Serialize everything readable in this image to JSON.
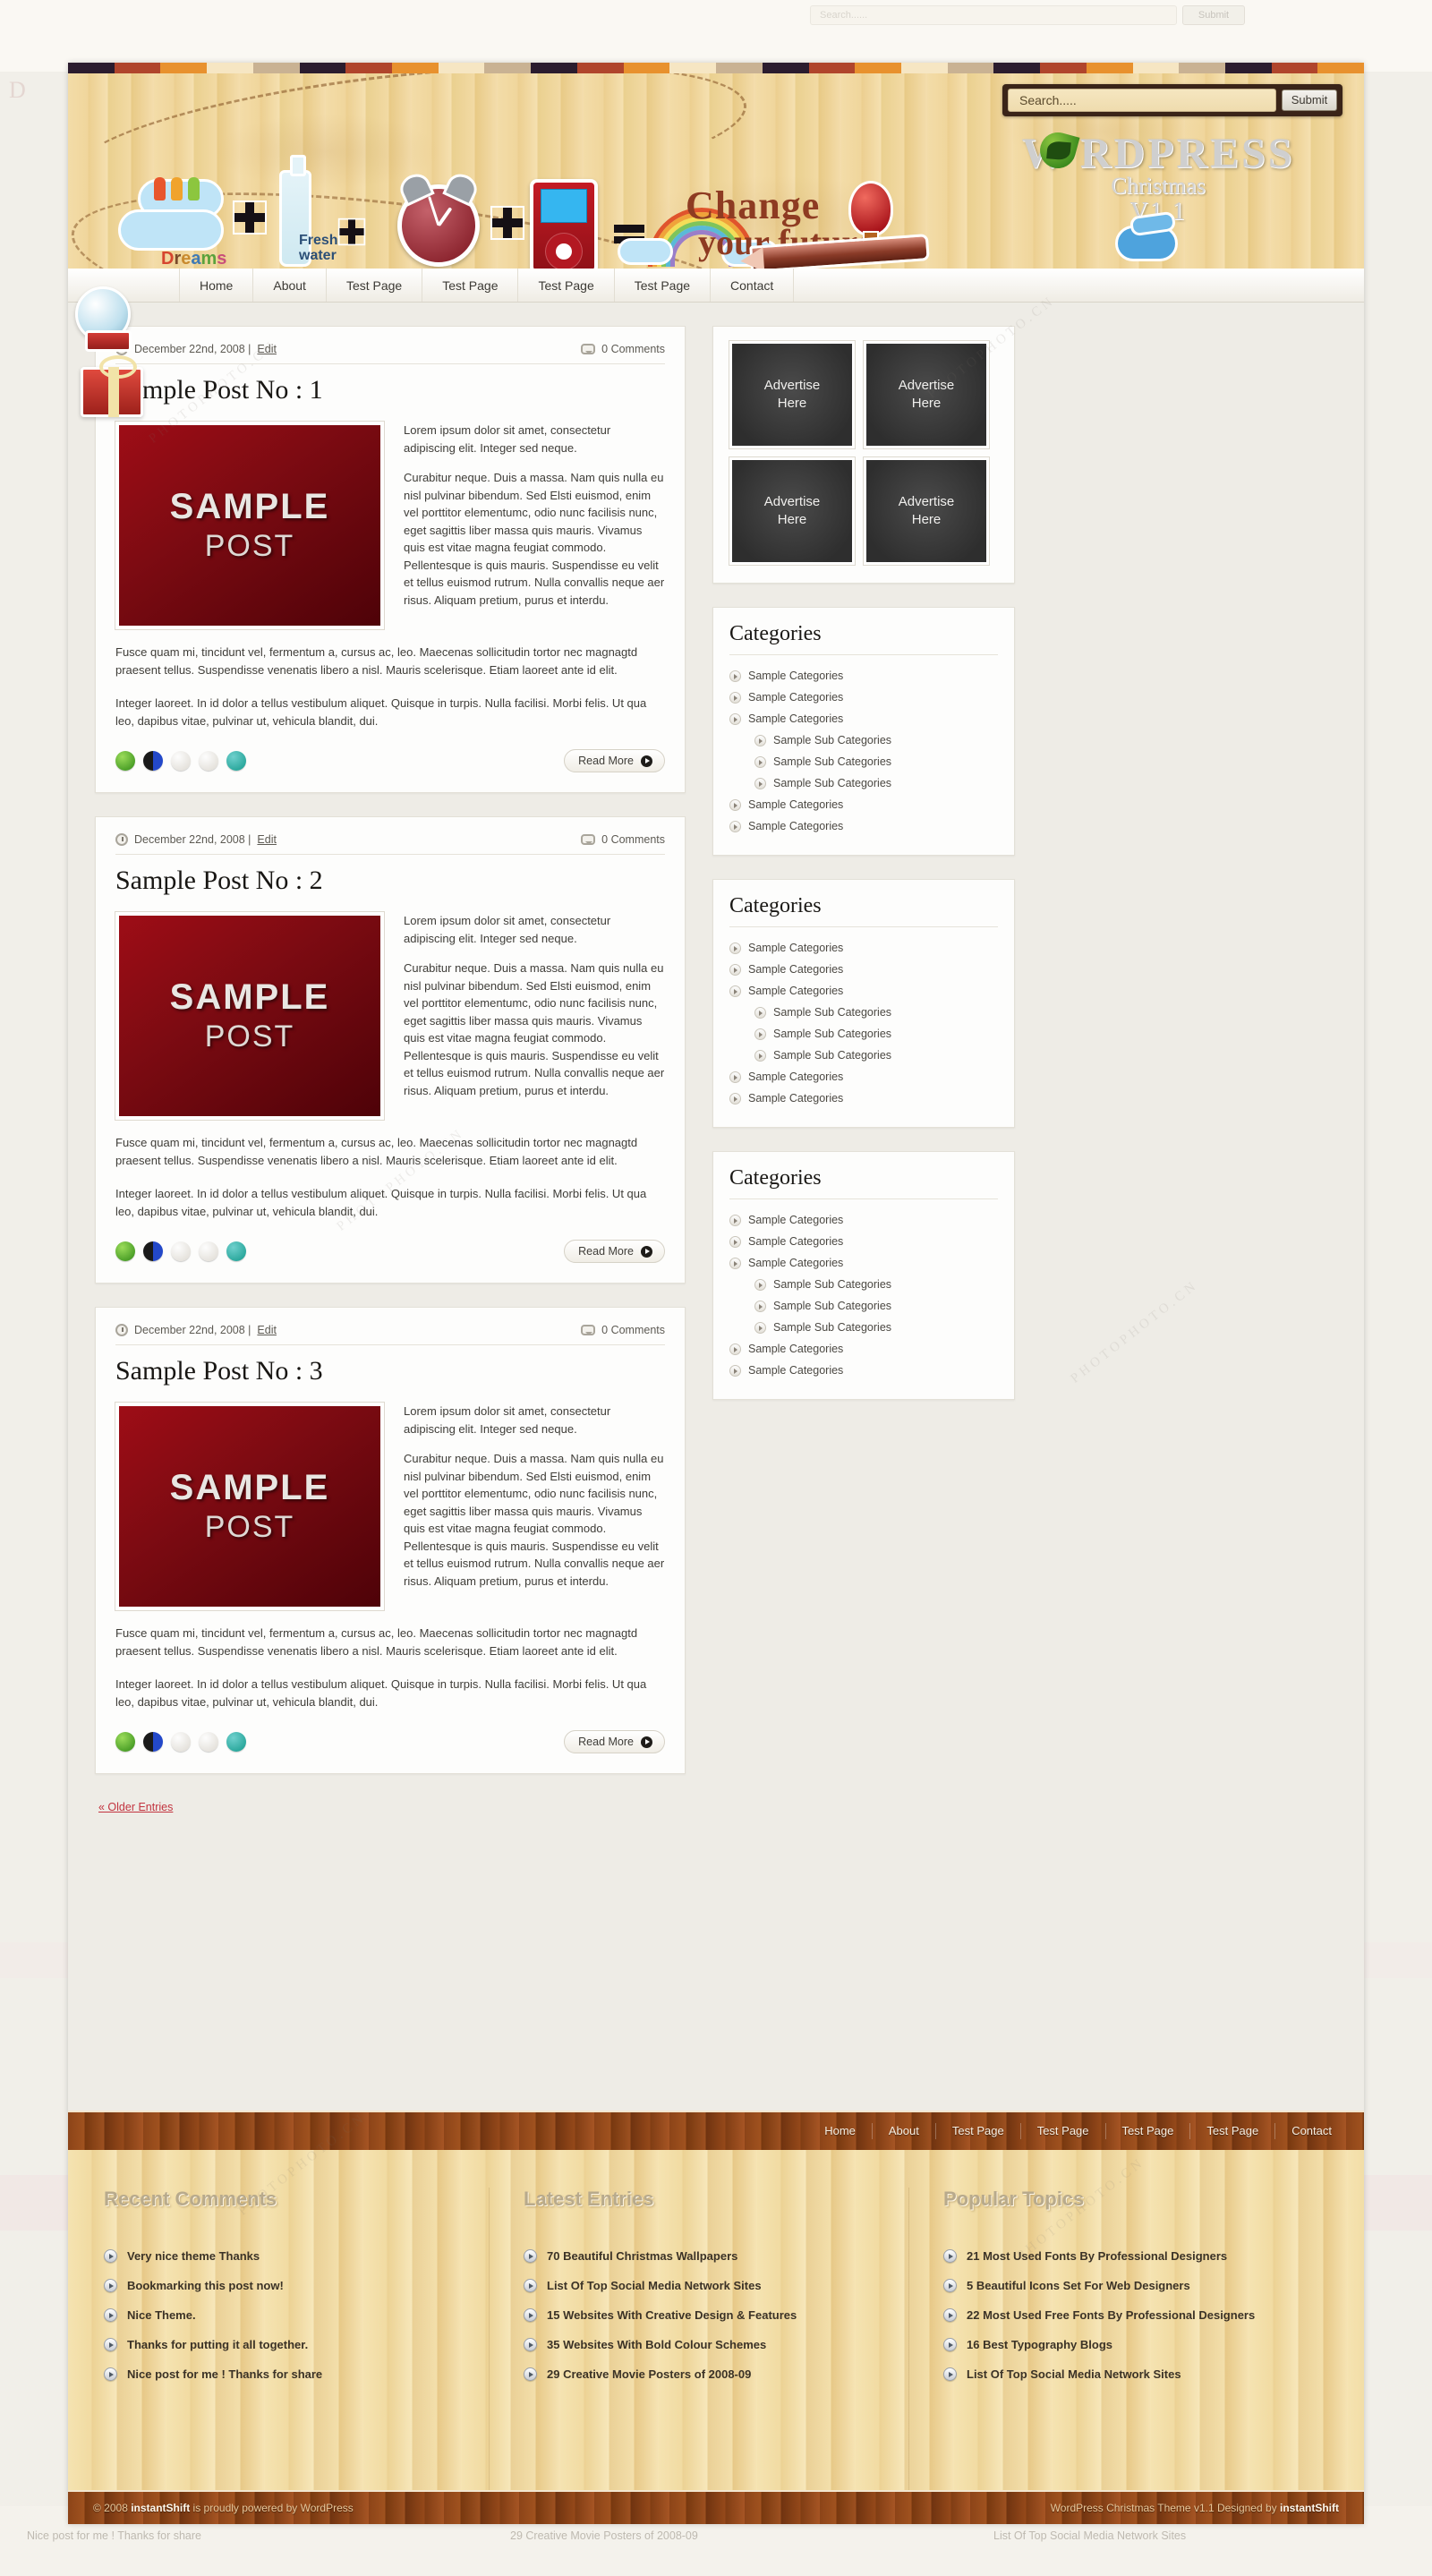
{
  "bleed": {
    "search_placeholder": "Search......",
    "submit_label": "Submit",
    "bottom_items": [
      "Nice post for me ! Thanks for share",
      "29 Creative Movie Posters of 2008-09",
      "List Of Top Social Media Network Sites"
    ]
  },
  "header": {
    "search_placeholder": "Search.....",
    "submit_label": "Submit",
    "logo": {
      "main": "W  RDPRESS",
      "sub": "Christmas",
      "version": "V1.1"
    },
    "illustration": {
      "dreams_label": "Dreams",
      "fresh_label_1": "Fresh",
      "fresh_label_2": "water",
      "tagline_1": "Change",
      "tagline_2": "your future"
    }
  },
  "nav": {
    "items": [
      {
        "label": "Home"
      },
      {
        "label": "About"
      },
      {
        "label": "Test Page"
      },
      {
        "label": "Test Page"
      },
      {
        "label": "Test Page"
      },
      {
        "label": "Test Page"
      },
      {
        "label": "Contact"
      }
    ]
  },
  "posts": [
    {
      "date": "December 22nd, 2008 |",
      "edit": "Edit",
      "comments": "0 Comments",
      "title": "Sample Post No : 1",
      "image_line1": "SAMPLE",
      "image_line2": "POST",
      "intro_1": "Lorem ipsum dolor sit amet, consectetur adipiscing elit. Integer sed neque.",
      "intro_2": "Curabitur neque. Duis a massa. Nam quis nulla eu nisl pulvinar bibendum. Sed Elsti euismod, enim vel porttitor elementumc, odio nunc facilisis nunc, eget sagittis liber massa quis mauris. Vivamus quis est vitae magna feugiat commodo. Pellentesque is quis mauris. Suspendisse eu velit et tellus euismod rutrum. Nulla convallis neque aer risus. Aliquam pretium, purus et interdu.",
      "body_1": "Fusce quam mi, tincidunt vel, fermentum a, cursus ac, leo. Maecenas sollicitudin tortor nec magnagtd praesent tellus. Suspendisse venenatis libero a nisl. Mauris scelerisque. Etiam laoreet ante id elit.",
      "body_2": "Integer laoreet. In id dolor a tellus vestibulum aliquet. Quisque in turpis. Nulla facilisi. Morbi felis. Ut qua leo, dapibus vitae, pulvinar ut, vehicula blandit, dui.",
      "read_more": "Read More"
    },
    {
      "date": "December 22nd, 2008 |",
      "edit": "Edit",
      "comments": "0 Comments",
      "title": "Sample Post No : 2",
      "image_line1": "SAMPLE",
      "image_line2": "POST",
      "intro_1": "Lorem ipsum dolor sit amet, consectetur adipiscing elit. Integer sed neque.",
      "intro_2": "Curabitur neque. Duis a massa. Nam quis nulla eu nisl pulvinar bibendum. Sed Elsti euismod, enim vel porttitor elementumc, odio nunc facilisis nunc, eget sagittis liber massa quis mauris. Vivamus quis est vitae magna feugiat commodo. Pellentesque is quis mauris. Suspendisse eu velit et tellus euismod rutrum. Nulla convallis neque aer risus. Aliquam pretium, purus et interdu.",
      "body_1": "Fusce quam mi, tincidunt vel, fermentum a, cursus ac, leo. Maecenas sollicitudin tortor nec magnagtd praesent tellus. Suspendisse venenatis libero a nisl. Mauris scelerisque. Etiam laoreet ante id elit.",
      "body_2": "Integer laoreet. In id dolor a tellus vestibulum aliquet. Quisque in turpis. Nulla facilisi. Morbi felis. Ut qua leo, dapibus vitae, pulvinar ut, vehicula blandit, dui.",
      "read_more": "Read More"
    },
    {
      "date": "December 22nd, 2008 |",
      "edit": "Edit",
      "comments": "0 Comments",
      "title": "Sample Post No : 3",
      "image_line1": "SAMPLE",
      "image_line2": "POST",
      "intro_1": "Lorem ipsum dolor sit amet, consectetur adipiscing elit. Integer sed neque.",
      "intro_2": "Curabitur neque. Duis a massa. Nam quis nulla eu nisl pulvinar bibendum. Sed Elsti euismod, enim vel porttitor elementumc, odio nunc facilisis nunc, eget sagittis liber massa quis mauris. Vivamus quis est vitae magna feugiat commodo. Pellentesque is quis mauris. Suspendisse eu velit et tellus euismod rutrum. Nulla convallis neque aer risus. Aliquam pretium, purus et interdu.",
      "body_1": "Fusce quam mi, tincidunt vel, fermentum a, cursus ac, leo. Maecenas sollicitudin tortor nec magnagtd praesent tellus. Suspendisse venenatis libero a nisl. Mauris scelerisque. Etiam laoreet ante id elit.",
      "body_2": "Integer laoreet. In id dolor a tellus vestibulum aliquet. Quisque in turpis. Nulla facilisi. Morbi felis. Ut qua leo, dapibus vitae, pulvinar ut, vehicula blandit, dui.",
      "read_more": "Read More"
    }
  ],
  "pagination": {
    "older_label": "« Older Entries"
  },
  "social_icons": [
    {
      "name": "technorati-icon",
      "glyph": ""
    },
    {
      "name": "mixx-icon",
      "glyph": ""
    },
    {
      "name": "yahoo-buzz-icon",
      "glyph": ""
    },
    {
      "name": "reddit-icon",
      "glyph": ""
    },
    {
      "name": "stumbleupon-icon",
      "glyph": "su"
    }
  ],
  "sidebar": {
    "ads": [
      {
        "line1": "Advertise",
        "line2": "Here"
      },
      {
        "line1": "Advertise",
        "line2": "Here"
      },
      {
        "line1": "Advertise",
        "line2": "Here"
      },
      {
        "line1": "Advertise",
        "line2": "Here"
      }
    ],
    "category_widgets": [
      {
        "title": "Categories",
        "items": [
          {
            "label": "Sample Categories",
            "sub": false
          },
          {
            "label": "Sample Categories",
            "sub": false
          },
          {
            "label": "Sample Categories",
            "sub": false
          },
          {
            "label": "Sample Sub Categories",
            "sub": true
          },
          {
            "label": "Sample Sub Categories",
            "sub": true
          },
          {
            "label": "Sample Sub Categories",
            "sub": true
          },
          {
            "label": "Sample Categories",
            "sub": false
          },
          {
            "label": "Sample Categories",
            "sub": false
          }
        ]
      },
      {
        "title": "Categories",
        "items": [
          {
            "label": "Sample Categories",
            "sub": false
          },
          {
            "label": "Sample Categories",
            "sub": false
          },
          {
            "label": "Sample Categories",
            "sub": false
          },
          {
            "label": "Sample Sub Categories",
            "sub": true
          },
          {
            "label": "Sample Sub Categories",
            "sub": true
          },
          {
            "label": "Sample Sub Categories",
            "sub": true
          },
          {
            "label": "Sample Categories",
            "sub": false
          },
          {
            "label": "Sample Categories",
            "sub": false
          }
        ]
      },
      {
        "title": "Categories",
        "items": [
          {
            "label": "Sample Categories",
            "sub": false
          },
          {
            "label": "Sample Categories",
            "sub": false
          },
          {
            "label": "Sample Categories",
            "sub": false
          },
          {
            "label": "Sample Sub Categories",
            "sub": true
          },
          {
            "label": "Sample Sub Categories",
            "sub": true
          },
          {
            "label": "Sample Sub Categories",
            "sub": true
          },
          {
            "label": "Sample Categories",
            "sub": false
          },
          {
            "label": "Sample Categories",
            "sub": false
          }
        ]
      }
    ]
  },
  "footer_nav": {
    "items": [
      {
        "label": "Home"
      },
      {
        "label": "About"
      },
      {
        "label": "Test Page"
      },
      {
        "label": "Test Page"
      },
      {
        "label": "Test Page"
      },
      {
        "label": "Test Page"
      },
      {
        "label": "Contact"
      }
    ]
  },
  "footer_widgets": [
    {
      "title": "Recent Comments",
      "items": [
        "Very nice theme Thanks",
        "Bookmarking this post now!",
        "Nice Theme.",
        "Thanks for putting it all together.",
        "Nice post for me ! Thanks for share"
      ]
    },
    {
      "title": "Latest Entries",
      "items": [
        "70 Beautiful Christmas Wallpapers",
        "List Of Top Social Media Network Sites",
        "15 Websites With Creative Design & Features",
        "35 Websites With Bold Colour Schemes",
        "29 Creative Movie Posters of 2008-09"
      ]
    },
    {
      "title": "Popular Topics",
      "items": [
        "21 Most Used Fonts By Professional Designers",
        "5 Beautiful Icons Set For Web Designers",
        "22 Most Used Free Fonts By Professional Designers",
        "16 Best Typography Blogs",
        "List Of Top Social Media Network Sites"
      ]
    }
  ],
  "copyright": {
    "left_prefix": "© 2008 ",
    "left_brand": "instantShift",
    "left_suffix": " is proudly powered by WordPress",
    "right_prefix": "WordPress Christmas Theme v1.1 Designed by ",
    "right_brand": "instantShift"
  },
  "colors": {
    "accent_red": "#c2343f",
    "wood_dark": "#8c4418",
    "wood_light": "#f3dca8",
    "page_bg": "#eeece6"
  },
  "ribbon_colors": [
    "#2b1c2e",
    "#b0452c",
    "#e8912e",
    "#f6e6c3",
    "#c9b293",
    "#2b1c2e",
    "#b0452c",
    "#e8912e",
    "#f6e6c3",
    "#c9b293",
    "#2b1c2e",
    "#b0452c",
    "#e8912e",
    "#f6e6c3",
    "#c9b293",
    "#2b1c2e",
    "#b0452c",
    "#e8912e",
    "#f6e6c3",
    "#c9b293"
  ],
  "rainbow_colors": [
    "#e0542c",
    "#f0a33a",
    "#f3de58",
    "#7ec45b",
    "#5ab9d8",
    "#9a7ec9"
  ]
}
